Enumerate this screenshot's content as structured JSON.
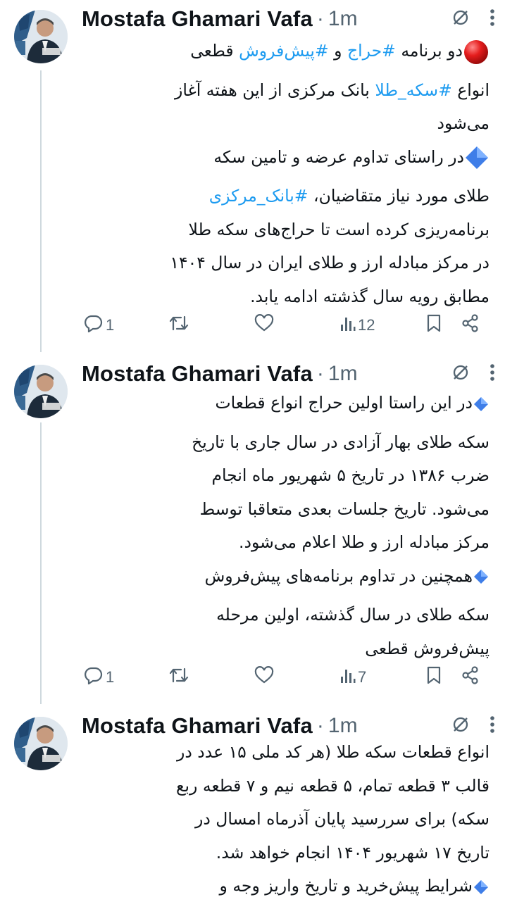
{
  "tweets": [
    {
      "author": "Mostafa Ghamari Vafa",
      "dot": "·",
      "time": "1m",
      "lines": [
        [
          "🔴 ",
          "دو برنامه ",
          "#حراج",
          " و ",
          "#پیش‌فروش",
          " قطعی"
        ],
        [
          "انواع ",
          "#سکه_طلا",
          " بانک مرکزی از این هفته آغاز"
        ],
        [
          "می‌شود"
        ],
        [
          "🔷 ",
          "در راستای تداوم عرضه و تامین سکه"
        ],
        [
          "طلای مورد نیاز متقاضیان، ",
          "#بانک_مرکزی"
        ],
        [
          "برنامه‌ریزی کرده است تا حراج‌های سکه طلا"
        ],
        [
          "در مرکز مبادله ارز و طلای ایران در سال ۱۴۰۴"
        ],
        [
          "مطابق رویه سال گذشته ادامه یابد."
        ]
      ],
      "replies": "1",
      "views": "12"
    },
    {
      "author": "Mostafa Ghamari Vafa",
      "dot": "·",
      "time": "1m",
      "lines": [
        [
          "🔹 ",
          "در این راستا اولین حراج انواع قطعات"
        ],
        [
          "سکه طلای بهار آزادی در سال جاری با تاریخ"
        ],
        [
          "ضرب ۱۳۸۶ در تاریخ ۵ شهریور ماه انجام"
        ],
        [
          "می‌شود. تاریخ جلسات بعدی متعاقبا توسط"
        ],
        [
          "مرکز مبادله ارز و طلا اعلام می‌شود."
        ],
        [
          "🔹 ",
          "همچنین در تداوم برنامه‌های پیش‌فروش"
        ],
        [
          "سکه طلای در سال گذشته، اولین مرحله"
        ],
        [
          "پیش‌فروش قطعی"
        ]
      ],
      "replies": "1",
      "views": "7"
    },
    {
      "author": "Mostafa Ghamari Vafa",
      "dot": "·",
      "time": "1m",
      "lines": [
        [
          "انواع قطعات سکه طلا (هر کد ملی ۱۵ عدد در"
        ],
        [
          "قالب ۳ قطعه تمام، ۵ قطعه نیم و ۷ قطعه ربع"
        ],
        [
          "سکه) برای سررسید پایان آذرماه امسال در"
        ],
        [
          "تاریخ ۱۷ شهریور ۱۴۰۴ انجام خواهد شد."
        ],
        [
          "🔹 ",
          "شرایط پیش‌خرید و تاریخ واریز وجه و"
        ]
      ]
    }
  ],
  "icons": {
    "grok": "grok-icon",
    "more": "more-vertical-icon",
    "reply": "reply-icon",
    "retweet": "retweet-icon",
    "like": "like-icon",
    "views": "views-icon",
    "bookmark": "bookmark-icon",
    "share": "share-icon"
  },
  "colors": {
    "hashtag": "#1d9bf0",
    "muted": "#536471",
    "thread": "#cfd9de"
  }
}
